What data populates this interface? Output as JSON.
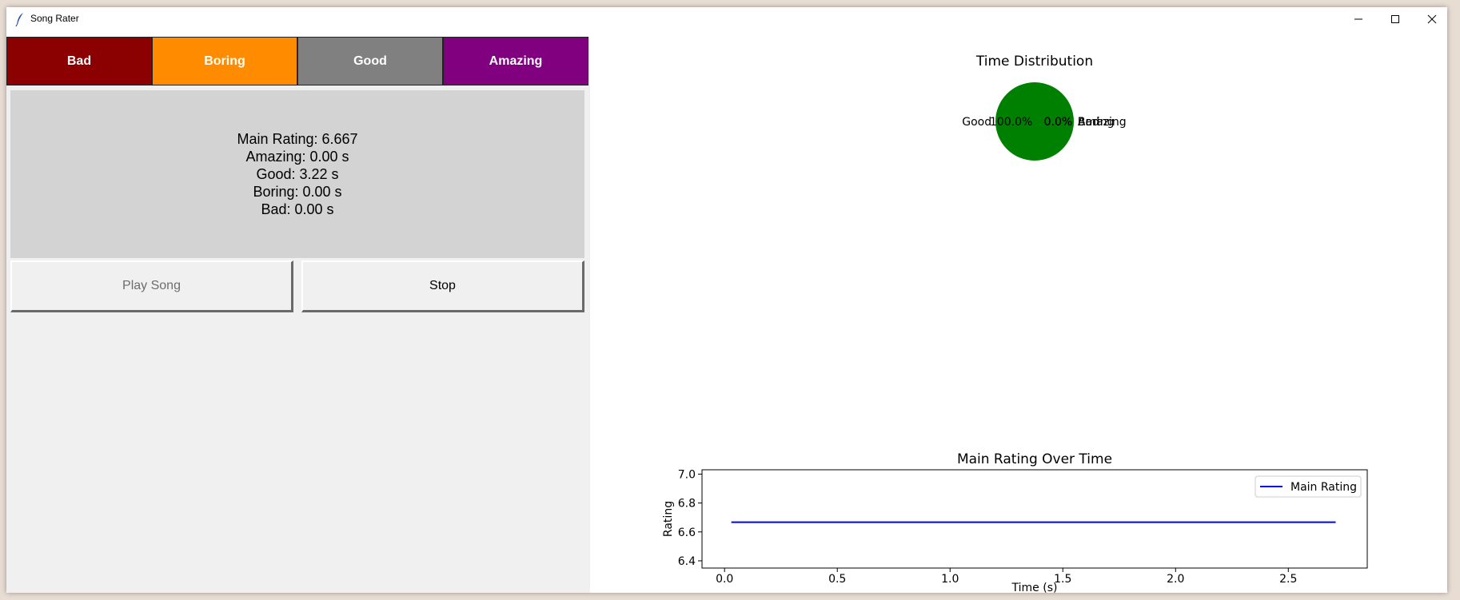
{
  "window": {
    "title": "Song Rater",
    "controls": [
      "minimize",
      "maximize",
      "close"
    ]
  },
  "rating_buttons": [
    {
      "label": "Bad",
      "color": "#8b0000"
    },
    {
      "label": "Boring",
      "color": "#ff8c00"
    },
    {
      "label": "Good",
      "color": "#808080"
    },
    {
      "label": "Amazing",
      "color": "#800080"
    }
  ],
  "stats": {
    "main_rating": "Main Rating: 6.667",
    "amazing": "Amazing: 0.00 s",
    "good": "Good: 3.22 s",
    "boring": "Boring: 0.00 s",
    "bad": "Bad: 0.00 s"
  },
  "actions": {
    "play_label": "Play Song",
    "stop_label": "Stop",
    "play_disabled": true
  },
  "chart_data": [
    {
      "type": "pie",
      "title": "Time Distribution",
      "labels": [
        "Good",
        "Bad",
        "Boring",
        "Amazing"
      ],
      "values": [
        100.0,
        0.0,
        0.0,
        0.0
      ],
      "autopct_labels": [
        "100.0%",
        "0.0%",
        "0.0%",
        "0.0%"
      ],
      "colors": [
        "#008000",
        "#8b0000",
        "#ff8c00",
        "#800080"
      ]
    },
    {
      "type": "line",
      "title": "Main Rating Over Time",
      "xlabel": "Time (s)",
      "ylabel": "Rating",
      "xlim": [
        -0.1,
        2.85
      ],
      "ylim": [
        6.35,
        7.03
      ],
      "xticks": [
        "0.0",
        "0.5",
        "1.0",
        "1.5",
        "2.0",
        "2.5"
      ],
      "yticks": [
        "6.4",
        "6.6",
        "6.8",
        "7.0"
      ],
      "legend_position": "top-right",
      "series": [
        {
          "name": "Main Rating",
          "color": "#0000ff",
          "x": [
            0.03,
            2.71
          ],
          "y": [
            6.667,
            6.667
          ]
        }
      ]
    }
  ]
}
